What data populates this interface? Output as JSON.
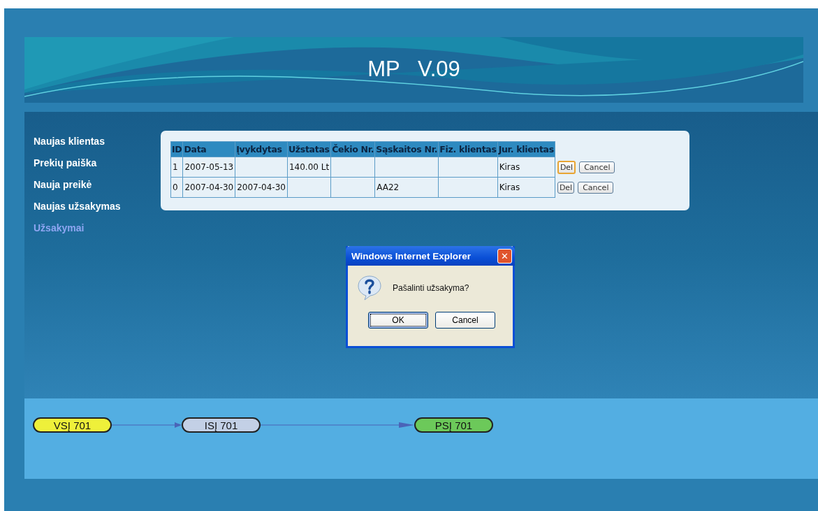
{
  "header": {
    "title": "MP   V.09"
  },
  "menu": [
    {
      "label": "Naujas klientas",
      "selected": false
    },
    {
      "label": "Prekių paiška",
      "selected": false
    },
    {
      "label": "Nauja preikė",
      "selected": false
    },
    {
      "label": "Naujas užsakymas",
      "selected": false
    },
    {
      "label": "Užsakymai",
      "selected": true
    }
  ],
  "table": {
    "columns": [
      "ID",
      "Data",
      "Įvykdytas",
      "Užstatas",
      "Čekio Nr.",
      "Sąskaitos Nr.",
      "Fiz. klientas",
      "Jur. klientas"
    ],
    "rows": [
      {
        "cells": [
          "1",
          "2007-05-13",
          "",
          "140.00 Lt",
          "",
          "",
          "",
          "Kiras"
        ],
        "delete": "Del",
        "cancel": "Cancel",
        "focused": true
      },
      {
        "cells": [
          "0",
          "2007-04-30",
          "2007-04-30",
          "",
          "",
          "AA22",
          "",
          "Kiras"
        ],
        "delete": "Del",
        "cancel": "Cancel",
        "focused": false
      }
    ]
  },
  "dialog": {
    "title": "Windows Internet Explorer",
    "close": "✕",
    "message": "Pašalinti užsakyma?",
    "buttons": [
      {
        "label": "OK",
        "focused": true
      },
      {
        "label": "Cancel",
        "focused": false
      }
    ]
  },
  "flow": [
    {
      "label": "VSĮ 701",
      "color": "#eef03a"
    },
    {
      "label": "ISĮ 701",
      "color": "#c3d0e6"
    },
    {
      "label": "PSĮ 701",
      "color": "#6cc95a"
    }
  ]
}
